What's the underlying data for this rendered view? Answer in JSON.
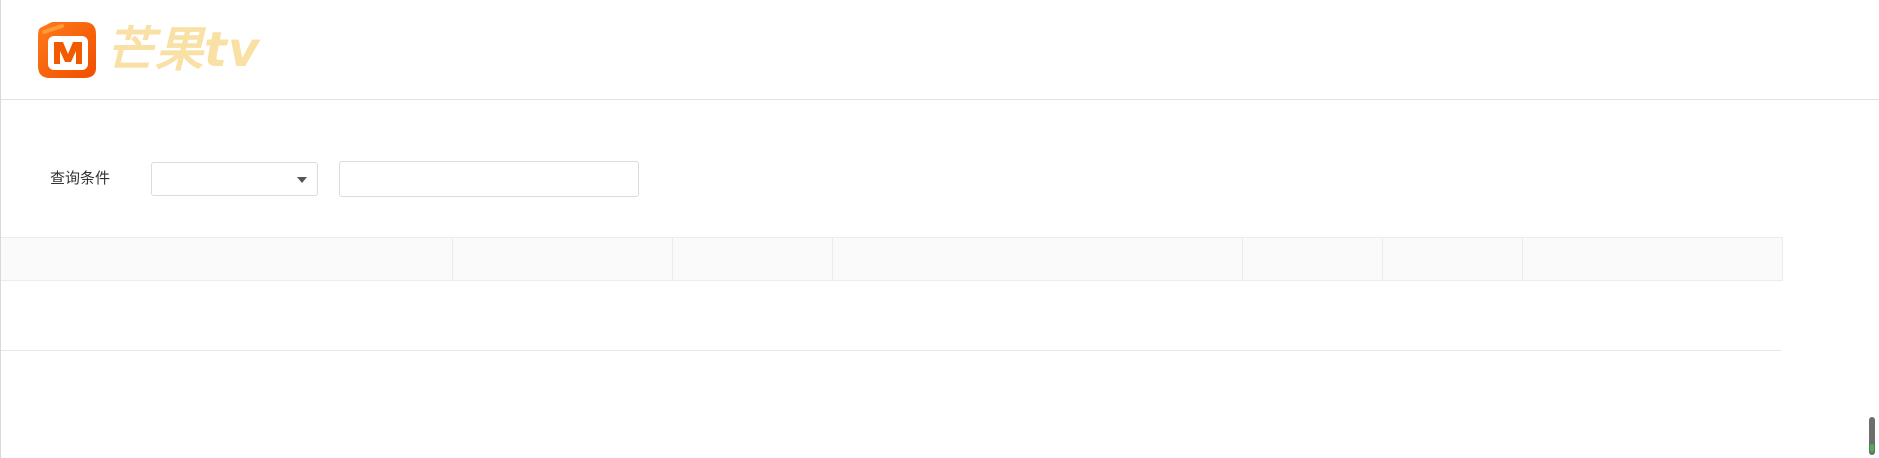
{
  "brand": {
    "logo_text": "芒果tv",
    "mark_color": "#ff5f00",
    "text_color": "#f9e0a4"
  },
  "filter": {
    "label": "查询条件",
    "select_value": "",
    "input_value": "",
    "input_placeholder": ""
  },
  "table": {
    "columns": [
      "",
      "",
      "",
      "",
      "",
      "",
      ""
    ],
    "rows": []
  }
}
